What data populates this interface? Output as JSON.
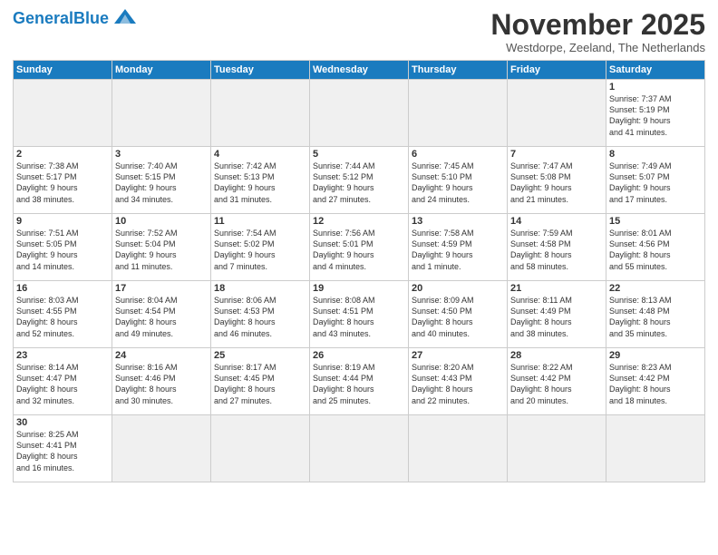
{
  "header": {
    "logo_general": "General",
    "logo_blue": "Blue",
    "month_title": "November 2025",
    "subtitle": "Westdorpe, Zeeland, The Netherlands"
  },
  "weekdays": [
    "Sunday",
    "Monday",
    "Tuesday",
    "Wednesday",
    "Thursday",
    "Friday",
    "Saturday"
  ],
  "weeks": [
    [
      {
        "day": "",
        "info": "",
        "empty": true
      },
      {
        "day": "",
        "info": "",
        "empty": true
      },
      {
        "day": "",
        "info": "",
        "empty": true
      },
      {
        "day": "",
        "info": "",
        "empty": true
      },
      {
        "day": "",
        "info": "",
        "empty": true
      },
      {
        "day": "",
        "info": "",
        "empty": true
      },
      {
        "day": "1",
        "info": "Sunrise: 7:37 AM\nSunset: 5:19 PM\nDaylight: 9 hours\nand 41 minutes."
      }
    ],
    [
      {
        "day": "2",
        "info": "Sunrise: 7:38 AM\nSunset: 5:17 PM\nDaylight: 9 hours\nand 38 minutes."
      },
      {
        "day": "3",
        "info": "Sunrise: 7:40 AM\nSunset: 5:15 PM\nDaylight: 9 hours\nand 34 minutes."
      },
      {
        "day": "4",
        "info": "Sunrise: 7:42 AM\nSunset: 5:13 PM\nDaylight: 9 hours\nand 31 minutes."
      },
      {
        "day": "5",
        "info": "Sunrise: 7:44 AM\nSunset: 5:12 PM\nDaylight: 9 hours\nand 27 minutes."
      },
      {
        "day": "6",
        "info": "Sunrise: 7:45 AM\nSunset: 5:10 PM\nDaylight: 9 hours\nand 24 minutes."
      },
      {
        "day": "7",
        "info": "Sunrise: 7:47 AM\nSunset: 5:08 PM\nDaylight: 9 hours\nand 21 minutes."
      },
      {
        "day": "8",
        "info": "Sunrise: 7:49 AM\nSunset: 5:07 PM\nDaylight: 9 hours\nand 17 minutes."
      }
    ],
    [
      {
        "day": "9",
        "info": "Sunrise: 7:51 AM\nSunset: 5:05 PM\nDaylight: 9 hours\nand 14 minutes."
      },
      {
        "day": "10",
        "info": "Sunrise: 7:52 AM\nSunset: 5:04 PM\nDaylight: 9 hours\nand 11 minutes."
      },
      {
        "day": "11",
        "info": "Sunrise: 7:54 AM\nSunset: 5:02 PM\nDaylight: 9 hours\nand 7 minutes."
      },
      {
        "day": "12",
        "info": "Sunrise: 7:56 AM\nSunset: 5:01 PM\nDaylight: 9 hours\nand 4 minutes."
      },
      {
        "day": "13",
        "info": "Sunrise: 7:58 AM\nSunset: 4:59 PM\nDaylight: 9 hours\nand 1 minute."
      },
      {
        "day": "14",
        "info": "Sunrise: 7:59 AM\nSunset: 4:58 PM\nDaylight: 8 hours\nand 58 minutes."
      },
      {
        "day": "15",
        "info": "Sunrise: 8:01 AM\nSunset: 4:56 PM\nDaylight: 8 hours\nand 55 minutes."
      }
    ],
    [
      {
        "day": "16",
        "info": "Sunrise: 8:03 AM\nSunset: 4:55 PM\nDaylight: 8 hours\nand 52 minutes."
      },
      {
        "day": "17",
        "info": "Sunrise: 8:04 AM\nSunset: 4:54 PM\nDaylight: 8 hours\nand 49 minutes."
      },
      {
        "day": "18",
        "info": "Sunrise: 8:06 AM\nSunset: 4:53 PM\nDaylight: 8 hours\nand 46 minutes."
      },
      {
        "day": "19",
        "info": "Sunrise: 8:08 AM\nSunset: 4:51 PM\nDaylight: 8 hours\nand 43 minutes."
      },
      {
        "day": "20",
        "info": "Sunrise: 8:09 AM\nSunset: 4:50 PM\nDaylight: 8 hours\nand 40 minutes."
      },
      {
        "day": "21",
        "info": "Sunrise: 8:11 AM\nSunset: 4:49 PM\nDaylight: 8 hours\nand 38 minutes."
      },
      {
        "day": "22",
        "info": "Sunrise: 8:13 AM\nSunset: 4:48 PM\nDaylight: 8 hours\nand 35 minutes."
      }
    ],
    [
      {
        "day": "23",
        "info": "Sunrise: 8:14 AM\nSunset: 4:47 PM\nDaylight: 8 hours\nand 32 minutes."
      },
      {
        "day": "24",
        "info": "Sunrise: 8:16 AM\nSunset: 4:46 PM\nDaylight: 8 hours\nand 30 minutes."
      },
      {
        "day": "25",
        "info": "Sunrise: 8:17 AM\nSunset: 4:45 PM\nDaylight: 8 hours\nand 27 minutes."
      },
      {
        "day": "26",
        "info": "Sunrise: 8:19 AM\nSunset: 4:44 PM\nDaylight: 8 hours\nand 25 minutes."
      },
      {
        "day": "27",
        "info": "Sunrise: 8:20 AM\nSunset: 4:43 PM\nDaylight: 8 hours\nand 22 minutes."
      },
      {
        "day": "28",
        "info": "Sunrise: 8:22 AM\nSunset: 4:42 PM\nDaylight: 8 hours\nand 20 minutes."
      },
      {
        "day": "29",
        "info": "Sunrise: 8:23 AM\nSunset: 4:42 PM\nDaylight: 8 hours\nand 18 minutes."
      }
    ],
    [
      {
        "day": "30",
        "info": "Sunrise: 8:25 AM\nSunset: 4:41 PM\nDaylight: 8 hours\nand 16 minutes."
      },
      {
        "day": "",
        "info": "",
        "empty": true
      },
      {
        "day": "",
        "info": "",
        "empty": true
      },
      {
        "day": "",
        "info": "",
        "empty": true
      },
      {
        "day": "",
        "info": "",
        "empty": true
      },
      {
        "day": "",
        "info": "",
        "empty": true
      },
      {
        "day": "",
        "info": "",
        "empty": true
      }
    ]
  ]
}
